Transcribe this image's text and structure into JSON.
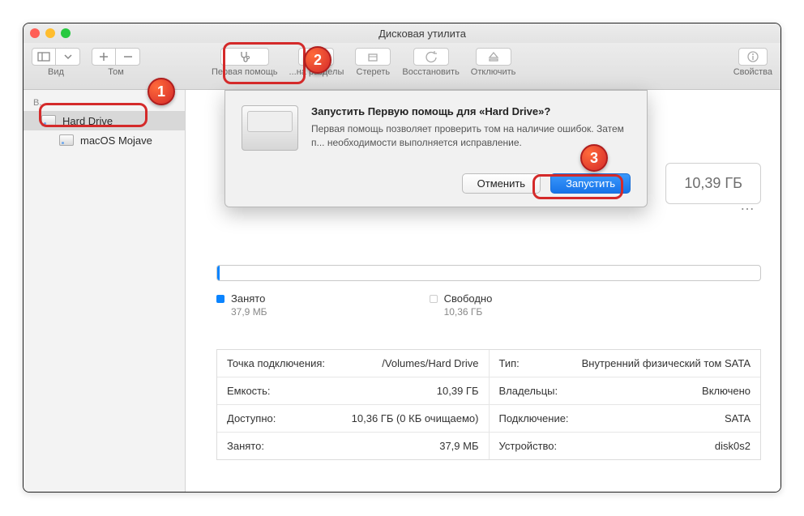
{
  "window": {
    "title": "Дисковая утилита"
  },
  "toolbar": {
    "view": "Вид",
    "volume": "Том",
    "first_aid": "Первая помощь",
    "partition": "...на разделы",
    "erase": "Стереть",
    "restore": "Восстановить",
    "unmount": "Отключить",
    "info": "Свойства"
  },
  "sidebar": {
    "header": "В...",
    "items": [
      {
        "label": "Hard Drive"
      },
      {
        "label": "macOS Mojave"
      }
    ]
  },
  "main": {
    "size": "10,39 ГБ",
    "usage": {
      "used_label": "Занято",
      "used_value": "37,9 МБ",
      "free_label": "Свободно",
      "free_value": "10,36 ГБ"
    },
    "info": {
      "mount_label": "Точка подключения:",
      "mount_value": "/Volumes/Hard Drive",
      "type_label": "Тип:",
      "type_value": "Внутренний физический том SATA",
      "capacity_label": "Емкость:",
      "capacity_value": "10,39 ГБ",
      "owners_label": "Владельцы:",
      "owners_value": "Включено",
      "available_label": "Доступно:",
      "available_value": "10,36 ГБ (0 КБ очищаемо)",
      "connection_label": "Подключение:",
      "connection_value": "SATA",
      "used_label": "Занято:",
      "used_value": "37,9 МБ",
      "device_label": "Устройство:",
      "device_value": "disk0s2"
    }
  },
  "dialog": {
    "title": "Запустить Первую помощь для «Hard Drive»?",
    "message": "Первая помощь позволяет проверить том на наличие ошибок. Затем п... необходимости выполняется исправление.",
    "cancel": "Отменить",
    "run": "Запустить"
  },
  "annotations": {
    "b1": "1",
    "b2": "2",
    "b3": "3"
  }
}
